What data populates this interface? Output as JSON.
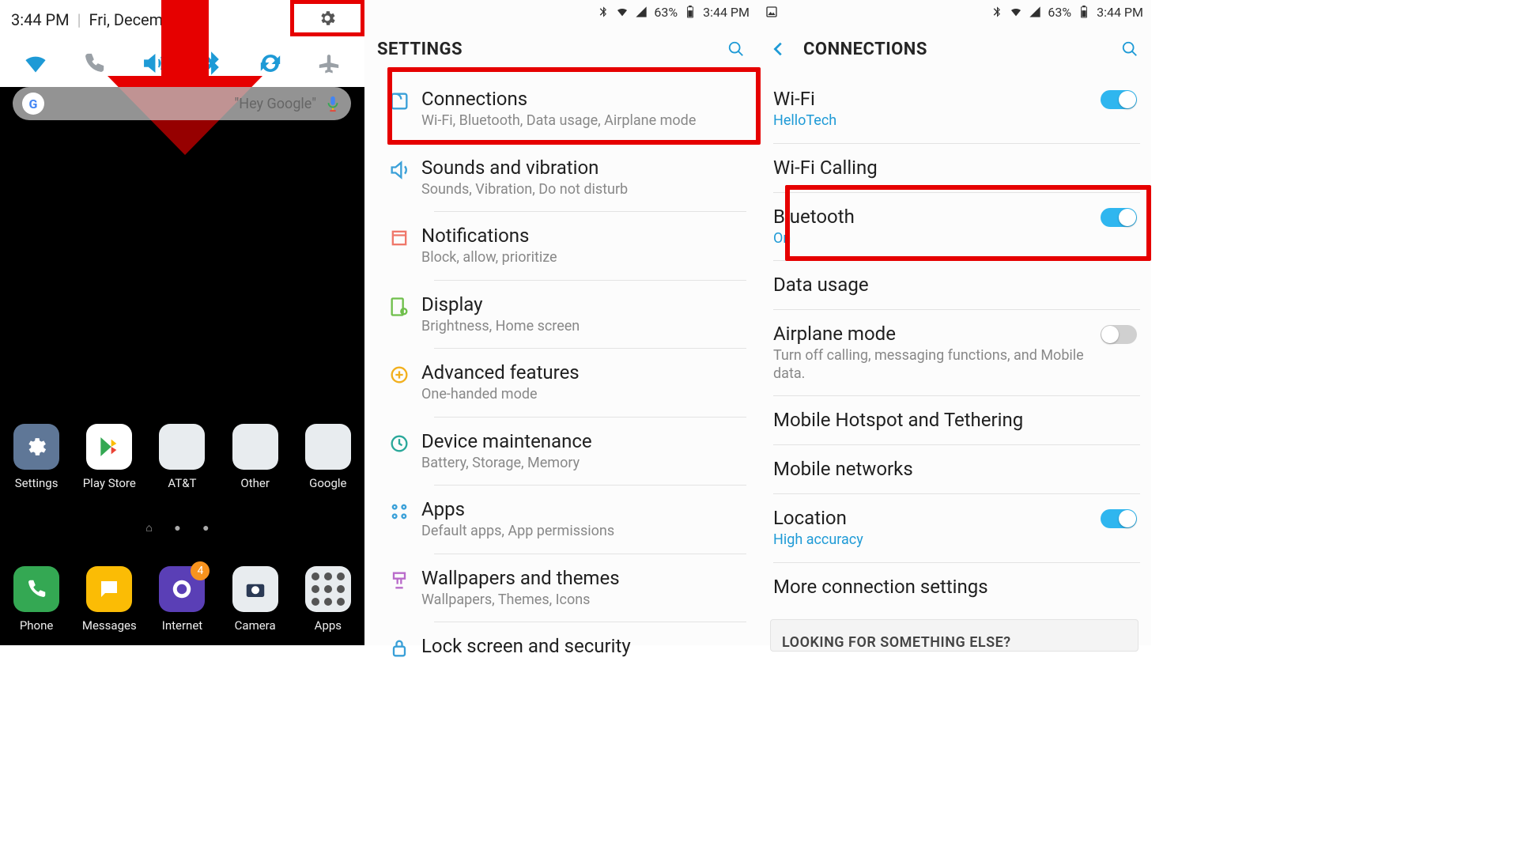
{
  "colors": {
    "highlight": "#e60000",
    "accent": "#1e9ad6",
    "toggle_on": "#2fb6ef"
  },
  "statusbar": {
    "battery_pct": "63%",
    "time": "3:44 PM"
  },
  "panel1": {
    "time": "3:44 PM",
    "date": "Fri, December",
    "gear_icon": "settings-gear",
    "quick_toggles": [
      {
        "name": "wifi",
        "on": true
      },
      {
        "name": "wificall",
        "on": false
      },
      {
        "name": "sound",
        "on": true
      },
      {
        "name": "bluetooth",
        "on": true
      },
      {
        "name": "sync",
        "on": true
      },
      {
        "name": "airplane",
        "on": false
      }
    ],
    "search_hint": "\"Hey Google\"",
    "apps_row1": [
      {
        "label": "Settings",
        "bg": "#5f7797"
      },
      {
        "label": "Play Store",
        "bg": "#ffffff"
      },
      {
        "label": "AT&T",
        "bg": "#e8ecef"
      },
      {
        "label": "Other",
        "bg": "#e8ecef"
      },
      {
        "label": "Google",
        "bg": "#e8ecef"
      }
    ],
    "apps_row2": [
      {
        "label": "Phone",
        "bg": "#34a853",
        "badge": null
      },
      {
        "label": "Messages",
        "bg": "#fbbc05",
        "badge": null
      },
      {
        "label": "Internet",
        "bg": "#5a3fb6",
        "badge": "4"
      },
      {
        "label": "Camera",
        "bg": "#e8ecef",
        "badge": null
      },
      {
        "label": "Apps",
        "bg": "#e8ecef",
        "badge": null
      }
    ]
  },
  "panel2": {
    "title": "SETTINGS",
    "items": [
      {
        "id": "connections",
        "title": "Connections",
        "sub": "Wi-Fi, Bluetooth, Data usage, Airplane mode",
        "icon": "connections",
        "tint": "#3aa0d8",
        "highlight": true
      },
      {
        "id": "sounds",
        "title": "Sounds and vibration",
        "sub": "Sounds, Vibration, Do not disturb",
        "icon": "sound",
        "tint": "#3aa0d8"
      },
      {
        "id": "notifs",
        "title": "Notifications",
        "sub": "Block, allow, prioritize",
        "icon": "notifications",
        "tint": "#ef776a"
      },
      {
        "id": "display",
        "title": "Display",
        "sub": "Brightness, Home screen",
        "icon": "display",
        "tint": "#6fbf4b"
      },
      {
        "id": "advanced",
        "title": "Advanced features",
        "sub": "One-handed mode",
        "icon": "advanced",
        "tint": "#f2b01e"
      },
      {
        "id": "device",
        "title": "Device maintenance",
        "sub": "Battery, Storage, Memory",
        "icon": "maintenance",
        "tint": "#2aa89a"
      },
      {
        "id": "apps",
        "title": "Apps",
        "sub": "Default apps, App permissions",
        "icon": "apps",
        "tint": "#3aa0d8"
      },
      {
        "id": "wallpapers",
        "title": "Wallpapers and themes",
        "sub": "Wallpapers, Themes, Icons",
        "icon": "wallpapers",
        "tint": "#b96bca"
      },
      {
        "id": "lockscreen",
        "title": "Lock screen and security",
        "sub": "",
        "icon": "lock",
        "tint": "#3aa0d8"
      }
    ]
  },
  "panel3": {
    "title": "CONNECTIONS",
    "items": [
      {
        "id": "wifi",
        "title": "Wi-Fi",
        "sub": "HelloTech",
        "sub_accent": true,
        "toggle": true
      },
      {
        "id": "wificall",
        "title": "Wi-Fi Calling",
        "sub": "",
        "toggle": null
      },
      {
        "id": "bt",
        "title": "Bluetooth",
        "sub": "On",
        "sub_accent": true,
        "toggle": true,
        "highlight": true
      },
      {
        "id": "data",
        "title": "Data usage",
        "sub": "",
        "toggle": null
      },
      {
        "id": "airplane",
        "title": "Airplane mode",
        "sub": "Turn off calling, messaging functions, and Mobile data.",
        "toggle": false
      },
      {
        "id": "hotspot",
        "title": "Mobile Hotspot and Tethering",
        "sub": "",
        "toggle": null
      },
      {
        "id": "mobile",
        "title": "Mobile networks",
        "sub": "",
        "toggle": null
      },
      {
        "id": "location",
        "title": "Location",
        "sub": "High accuracy",
        "sub_accent": true,
        "toggle": true
      },
      {
        "id": "more",
        "title": "More connection settings",
        "sub": "",
        "toggle": null
      }
    ],
    "footer": "LOOKING FOR SOMETHING ELSE?"
  }
}
